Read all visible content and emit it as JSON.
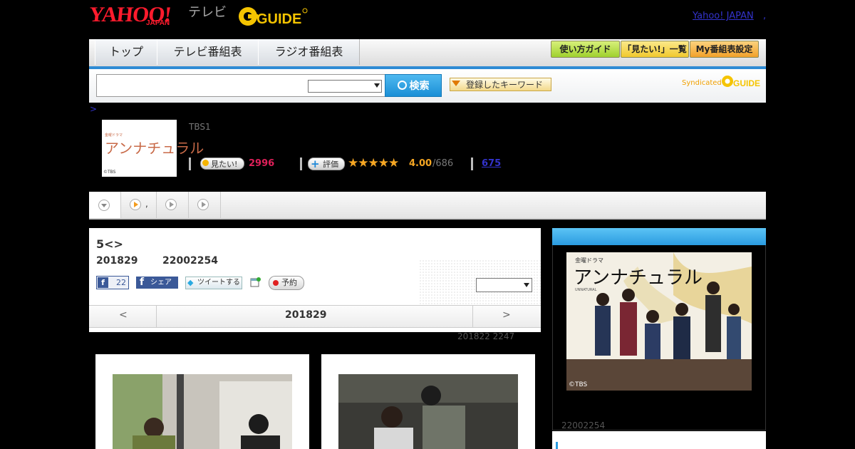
{
  "header": {
    "yahoo_logo": "YAHOO!",
    "japan_logo": "JAPAN",
    "tv_label": "テレビ",
    "gguide_logo": "GUIDE",
    "yahoo_japan_link": "Yahoo! JAPAN",
    "link_separator": ","
  },
  "nav": {
    "tabs": [
      "トップ",
      "テレビ番組表",
      "ラジオ番組表"
    ],
    "buttons": [
      "使い方ガイド",
      "「見たい!」一覧",
      "My番組表設定"
    ]
  },
  "search": {
    "button_label": "検索",
    "keyword_button": "登録したキーワード",
    "syndicated_label": "Syndicated",
    "syndicated_logo": "GUIDE"
  },
  "breadcrumb": ">",
  "program": {
    "thumb_title": "アンナチュラル",
    "thumb_sub": "金曜ドラマ",
    "thumb_copyright": "©TBS",
    "channel": "TBS1",
    "mitai_label": "見たい!",
    "mitai_count": "2996",
    "hyoka_label": "評価",
    "stars": "★★★★★",
    "rating": "4.00",
    "rating_count": "/686",
    "review_count": "675"
  },
  "subtabs": {
    "tab2_suffix": ","
  },
  "episode": {
    "title": "5<>",
    "date": "201829",
    "time": "22002254",
    "fb_count": "22",
    "fb_share": "シェア",
    "tweet": "ツイートする",
    "reserve": "予約",
    "prev": "<",
    "next": ">",
    "nav_date": "201829",
    "updated": "201822 2247"
  },
  "sidebar": {
    "poster_title": "アンナチュラル",
    "poster_sub": "金曜ドラマ",
    "poster_en": "UNNATURAL",
    "poster_copyright": "©TBS",
    "time": "22002254"
  },
  "colors": {
    "accent_blue": "#2a9be0",
    "mitai_pink": "#e0205a",
    "star_orange": "#f5a623",
    "facebook": "#3b5998"
  }
}
